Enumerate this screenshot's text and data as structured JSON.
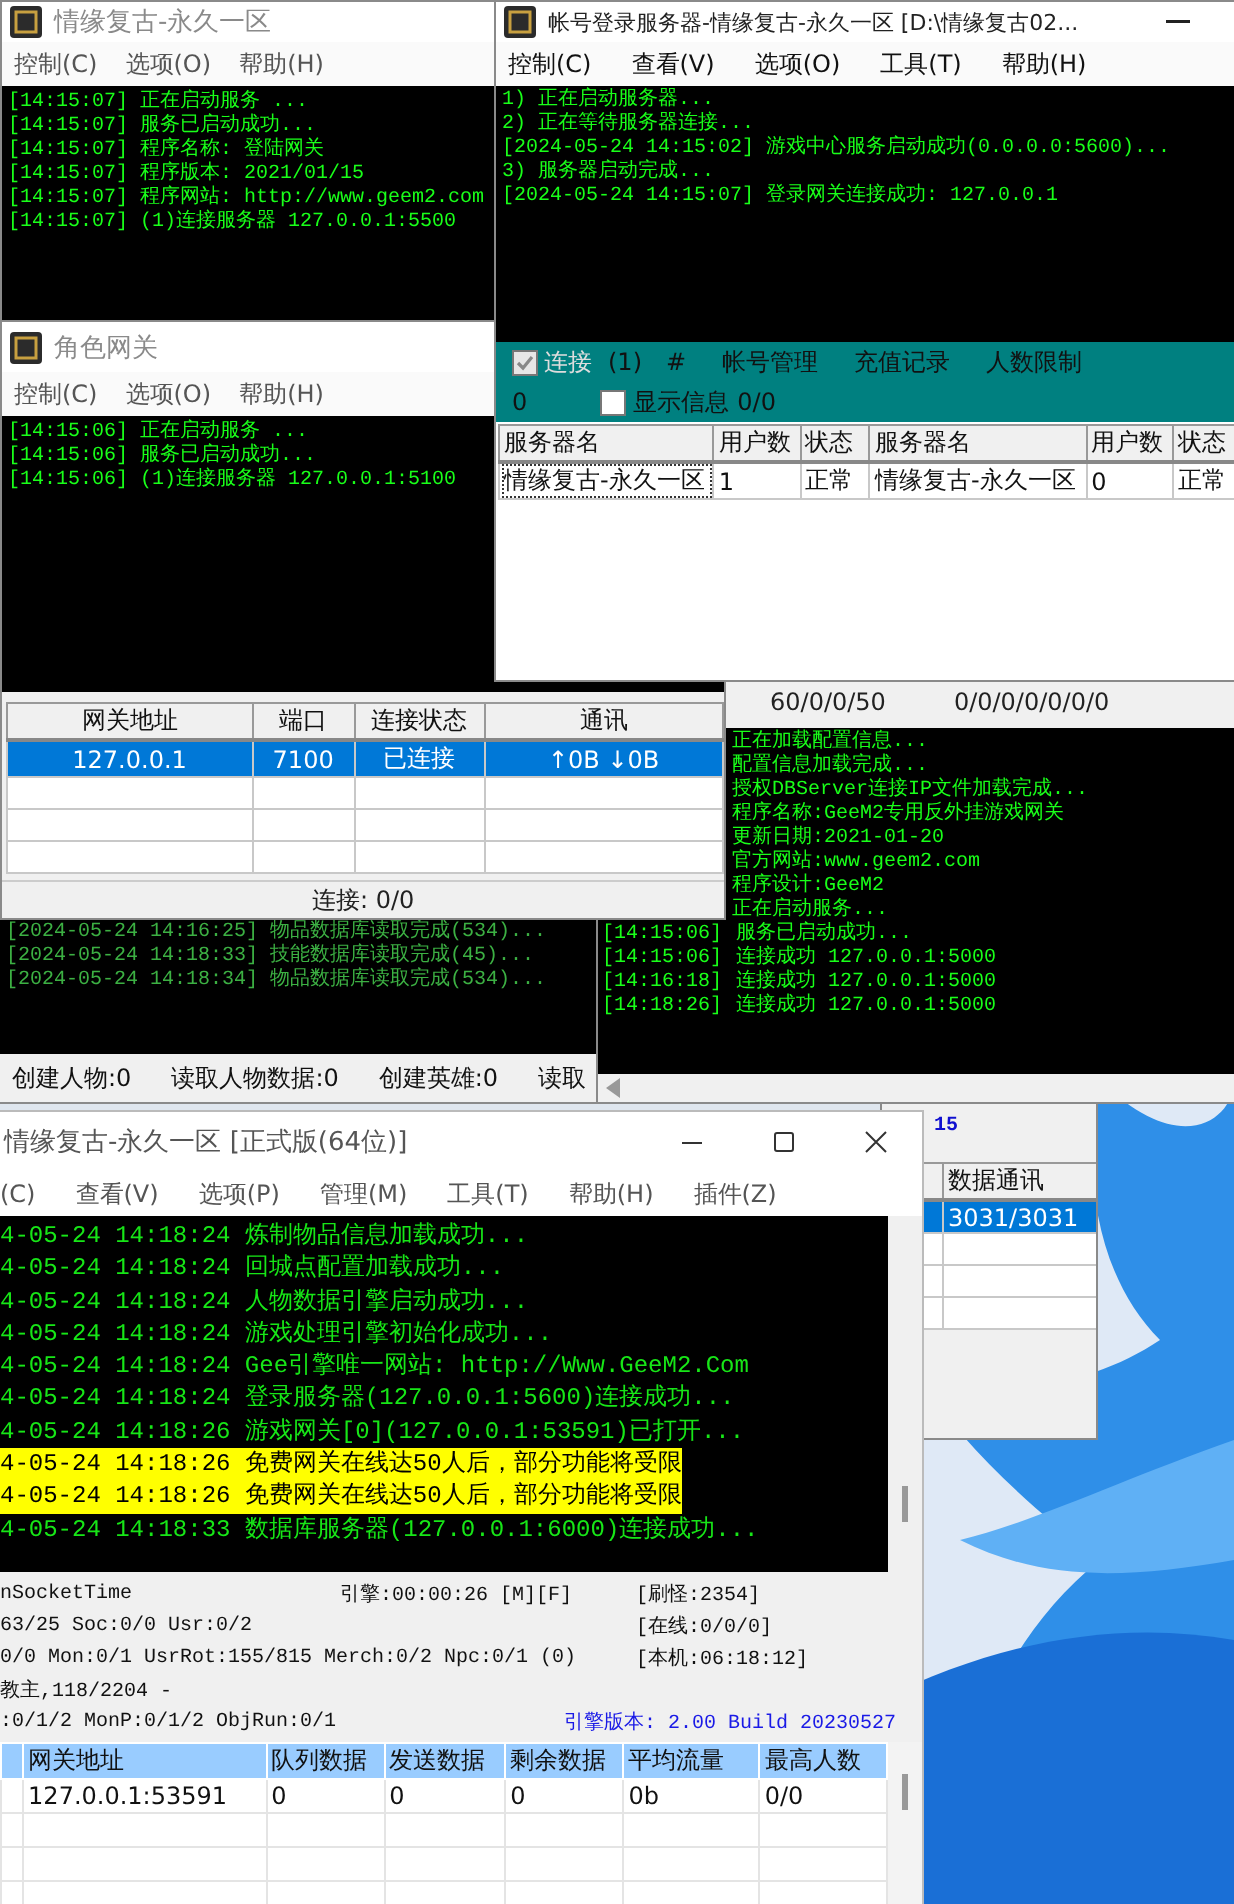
{
  "login_gateway_window": {
    "title": "情缘复古-永久一区",
    "menu": [
      "控制(C)",
      "选项(O)",
      "帮助(H)"
    ],
    "log": [
      "[14:15:07] 正在启动服务 ...",
      "[14:15:07] 服务已启动成功...",
      "[14:15:07] 程序名称: 登陆网关",
      "[14:15:07] 程序版本: 2021/01/15",
      "[14:15:07] 程序网站: http://www.geem2.com",
      "[14:15:07] (1)连接服务器 127.0.0.1:5500"
    ]
  },
  "account_server_window": {
    "title": "帐号登录服务器-情缘复古-永久一区  [D:\\情缘复古02...",
    "menu": [
      "控制(C)",
      "查看(V)",
      "选项(O)",
      "工具(T)",
      "帮助(H)"
    ],
    "log": [
      "1) 正在启动服务器...",
      "2) 正在等待服务器连接...",
      "[2024-05-24 14:15:02] 游戏中心服务启动成功(0.0.0.0:5600)...",
      "3) 服务器启动完成...",
      "[2024-05-24 14:15:07] 登录网关连接成功: 127.0.0.1"
    ],
    "toolbar": {
      "connect": {
        "label": "连接",
        "checked": true
      },
      "count": "(1)",
      "hash": "#",
      "links": [
        "帐号管理",
        "充值记录",
        "人数限制"
      ],
      "value": "0",
      "show_info": {
        "label": "显示信息",
        "checked": false
      },
      "ratio": "0/0"
    },
    "table": {
      "columns": [
        "服务器名",
        "用户数",
        "状态",
        "服务器名",
        "用户数",
        "状态"
      ],
      "rows": [
        {
          "cells": [
            "情缘复古-永久一区",
            "1",
            "正常",
            "情缘复古-永久一区",
            "0",
            "正常"
          ]
        }
      ]
    }
  },
  "role_gateway_window": {
    "title": "角色网关",
    "menu": [
      "控制(C)",
      "选项(O)",
      "帮助(H)"
    ],
    "log": [
      "[14:15:06] 正在启动服务 ...",
      "[14:15:06] 服务已启动成功...",
      "[14:15:06] (1)连接服务器 127.0.0.1:5100"
    ],
    "table": {
      "columns": [
        "网关地址",
        "端口",
        "连接状态",
        "通讯"
      ],
      "rows": [
        {
          "cells": [
            "127.0.0.1",
            "7100",
            "已连接",
            "↑0B  ↓0B"
          ],
          "selected": true
        }
      ]
    },
    "status": "连接: 0/0"
  },
  "db_server_window": {
    "log": [
      "[2024-05-24 14:16:25] 物品数据库读取完成(534)...",
      "[2024-05-24 14:18:33] 技能数据库读取完成(45)...",
      "[2024-05-24 14:18:34] 物品数据库读取完成(534)..."
    ],
    "stats": [
      "创建人物:0",
      "读取人物数据:0",
      "创建英雄:0",
      "读取"
    ]
  },
  "game_gateway_window": {
    "counters": [
      "60/0/0/50",
      "0/0/0/0/0/0/0"
    ],
    "log": [
      {
        "text": "正在加载配置信息..."
      },
      {
        "text": "配置信息加载完成..."
      },
      {
        "text": "授权DBServer连接IP文件加载完成..."
      },
      {
        "text": "程序名称:GeeM2专用反外挂游戏网关"
      },
      {
        "text": "更新日期:2021-01-20"
      },
      {
        "text": "官方网站:www.geem2.com"
      },
      {
        "text": "程序设计:GeeM2"
      },
      {
        "text": "正在启动服务..."
      },
      {
        "time": "[14:15:06]",
        "text": "服务已启动成功..."
      },
      {
        "time": "[14:15:06]",
        "text": "连接成功 127.0.0.1:5000"
      },
      {
        "time": "[14:16:18]",
        "text": "连接成功 127.0.0.1:5000"
      },
      {
        "time": "[14:18:26]",
        "text": "连接成功 127.0.0.1:5000"
      }
    ]
  },
  "data_window": {
    "label": "15",
    "table": {
      "columns": [
        "数据通讯"
      ],
      "rows": [
        {
          "cells": [
            "3031/3031"
          ],
          "selected": true
        }
      ]
    }
  },
  "m2_server_window": {
    "title": "情缘复古-永久一区 [正式版(64位)]",
    "menu": [
      "(C)",
      "查看(V)",
      "选项(P)",
      "管理(M)",
      "工具(T)",
      "帮助(H)",
      "插件(Z)"
    ],
    "log": [
      {
        "text": "4-05-24 14:18:24 炼制物品信息加载成功...",
        "highlighted": false
      },
      {
        "text": "4-05-24 14:18:24 回城点配置加载成功...",
        "highlighted": false
      },
      {
        "text": "4-05-24 14:18:24 人物数据引擎启动成功...",
        "highlighted": false
      },
      {
        "text": "4-05-24 14:18:24 游戏处理引擎初始化成功...",
        "highlighted": false
      },
      {
        "text": "4-05-24 14:18:24 Gee引擎唯一网站: http://Www.GeeM2.Com",
        "highlighted": false
      },
      {
        "text": "4-05-24 14:18:24 登录服务器(127.0.0.1:5600)连接成功...",
        "highlighted": false
      },
      {
        "text": "4-05-24 14:18:26 游戏网关[0](127.0.0.1:53591)已打开...",
        "highlighted": false
      },
      {
        "text": "4-05-24 14:18:26 免费网关在线达50人后，部分功能将受限",
        "highlighted": true
      },
      {
        "text": "4-05-24 14:18:26 免费网关在线达50人后，部分功能将受限",
        "highlighted": true
      },
      {
        "text": "4-05-24 14:18:33 数据库服务器(127.0.0.1:6000)连接成功...",
        "highlighted": false
      }
    ],
    "status": {
      "lines": [
        "nSocketTime",
        "63/25 Soc:0/0 Usr:0/2",
        "0/0 Mon:0/1 UsrRot:155/815 Merch:0/2 Npc:0/1 (0)",
        "教主,118/2204 -",
        ":0/1/2 MonP:0/1/2 ObjRun:0/1"
      ],
      "engine_time": "引擎:00:00:26 [M][F]",
      "counters": [
        "[刷怪:2354]",
        "[在线:0/0/0]",
        "[本机:06:18:12]"
      ],
      "version": "引擎版本: 2.00 Build 20230527"
    },
    "table": {
      "columns": [
        "网关地址",
        "队列数据",
        "发送数据",
        "剩余数据",
        "平均流量",
        "最高人数"
      ],
      "rows": [
        {
          "cells": [
            "127.0.0.1:53591",
            "0",
            "0",
            "0",
            "0b",
            "0/0"
          ]
        }
      ]
    }
  }
}
